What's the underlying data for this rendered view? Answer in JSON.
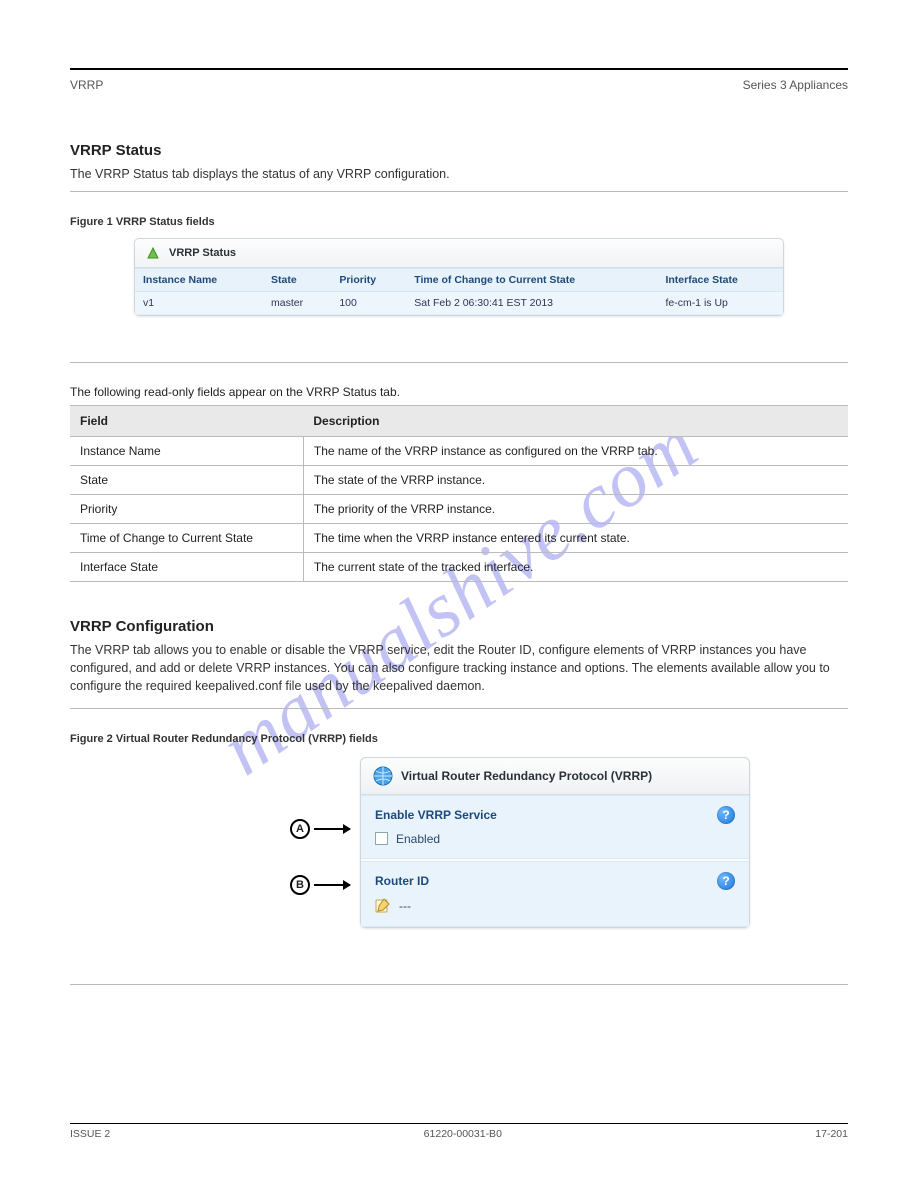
{
  "header": {
    "left": "VRRP",
    "right": "Series 3 Appliances"
  },
  "sec1": {
    "title": "VRRP Status",
    "intro": "The VRRP Status tab displays the status of any VRRP configuration."
  },
  "fig1": {
    "label": "Figure 1  VRRP Status fields",
    "panel_title": "VRRP Status",
    "columns": [
      "Instance Name",
      "State",
      "Priority",
      "Time of Change to Current State",
      "Interface State"
    ],
    "row": {
      "instance": "v1",
      "state": "master",
      "priority": "100",
      "time": "Sat Feb 2 06:30:41 EST 2013",
      "iface": "fe-cm-1 is Up"
    }
  },
  "fields_intro": "The following read-only fields appear on the VRRP Status tab.",
  "fields_table": {
    "head": [
      "Field",
      "Description"
    ],
    "rows": [
      {
        "field": "Instance Name",
        "desc": "The name of the VRRP instance as configured on the VRRP tab."
      },
      {
        "field": "State",
        "desc": "The state of the VRRP instance."
      },
      {
        "field": "Priority",
        "desc": "The priority of the VRRP instance."
      },
      {
        "field": "Time of Change to Current State",
        "desc": "The time when the VRRP instance entered its current state."
      },
      {
        "field": "Interface State",
        "desc": "The current state of the tracked interface."
      }
    ]
  },
  "sec2": {
    "title": "VRRP Configuration",
    "para": "The VRRP tab allows you to enable or disable the VRRP service, edit the Router ID, configure elements of VRRP instances you have configured, and add or delete VRRP instances. You can also configure tracking instance and options. The elements available allow you to configure the required keepalived.conf file used by the keepalived daemon."
  },
  "fig2": {
    "label": "Figure 2  Virtual Router Redundancy Protocol (VRRP) fields",
    "panel_title": "Virtual Router Redundancy Protocol (VRRP)",
    "enable_title": "Enable VRRP Service",
    "enable_label": "Enabled",
    "router_title": "Router ID",
    "router_value": "---",
    "callouts": {
      "a": "A",
      "b": "B"
    }
  },
  "footer": {
    "left": "ISSUE 2",
    "center": "61220-00031-B0",
    "right": "17-201"
  }
}
